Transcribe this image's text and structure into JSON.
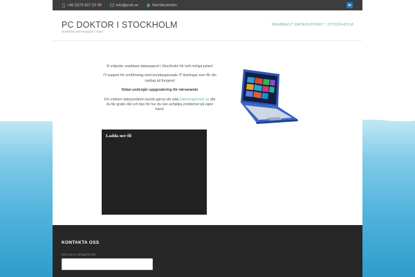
{
  "topbar": {
    "phone": "+46 (0)76 927 22 08",
    "email": "info@pcdr.se",
    "location": "StorStockholm",
    "linkedin_label": "in"
  },
  "header": {
    "site_title": "PC DOKTOR I STOCKHOLM",
    "tagline": "Snabbast datorsupport i stan!",
    "nav_link": "SNABBAST DATASUPPORT I STOCKHOLM"
  },
  "content": {
    "p1": "Vi erbjuder snabbast datasupport i Stockholm för helt rimliga priser!",
    "p2": "IT-support för småföretag med kundanpassade IT-lösningar som får din vardag att fungera!",
    "p3": "Sidan undergår uppgradering för närvarande",
    "p4_before": "För enklare datorproblem besök gärna vår sida ",
    "p4_link": "Datorsupporten.se",
    "p4_after": " där du får gratis råd och tips för hur du kan avhjälpa problemet på egen hand."
  },
  "video": {
    "title": "Ladda ner fil"
  },
  "footer": {
    "title": "KONTAKTA OSS",
    "name_label": "Ditt namn (obligatorisk)",
    "name_value": ""
  },
  "colors": {
    "accent": "#56b7a6",
    "topbar": "#3d3d3d",
    "footer": "#272727",
    "linkedin": "#1f77b4"
  }
}
